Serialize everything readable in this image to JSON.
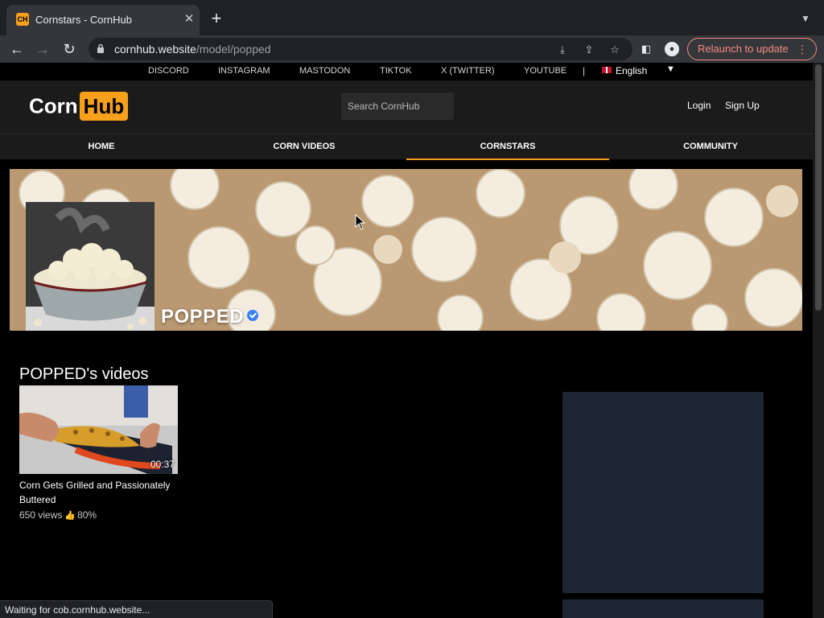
{
  "browser": {
    "tab_title": "Cornstars - CornHub",
    "favicon_label": "CH",
    "url_host": "cornhub.website",
    "url_path": "/model/popped",
    "relaunch_label": "Relaunch to update"
  },
  "social_links": [
    "DISCORD",
    "INSTAGRAM",
    "MASTODON",
    "TIKTOK",
    "X (TWITTER)",
    "YOUTUBE"
  ],
  "separator": "|",
  "language": "English",
  "logo": {
    "corn": "Corn",
    "hub": "Hub"
  },
  "search": {
    "placeholder": "Search CornHub"
  },
  "auth": {
    "login": "Login",
    "signup": "Sign Up"
  },
  "nav": {
    "items": [
      "HOME",
      "CORN VIDEOS",
      "CORNSTARS",
      "COMMUNITY"
    ],
    "active": "CORNSTARS"
  },
  "model": {
    "name": "POPPED",
    "verified": true
  },
  "videos_section": {
    "title": "POPPED's videos"
  },
  "videos": [
    {
      "title": "Corn Gets Grilled and Passionately Buttered",
      "duration": "00:37",
      "views": "650 views",
      "rating": "80%"
    }
  ],
  "status_bar": "Waiting for cob.cornhub.website...",
  "colors": {
    "accent": "#f7a01c",
    "background": "#000000",
    "header": "#1b1b1b",
    "ad_placeholder": "#1e2533"
  }
}
